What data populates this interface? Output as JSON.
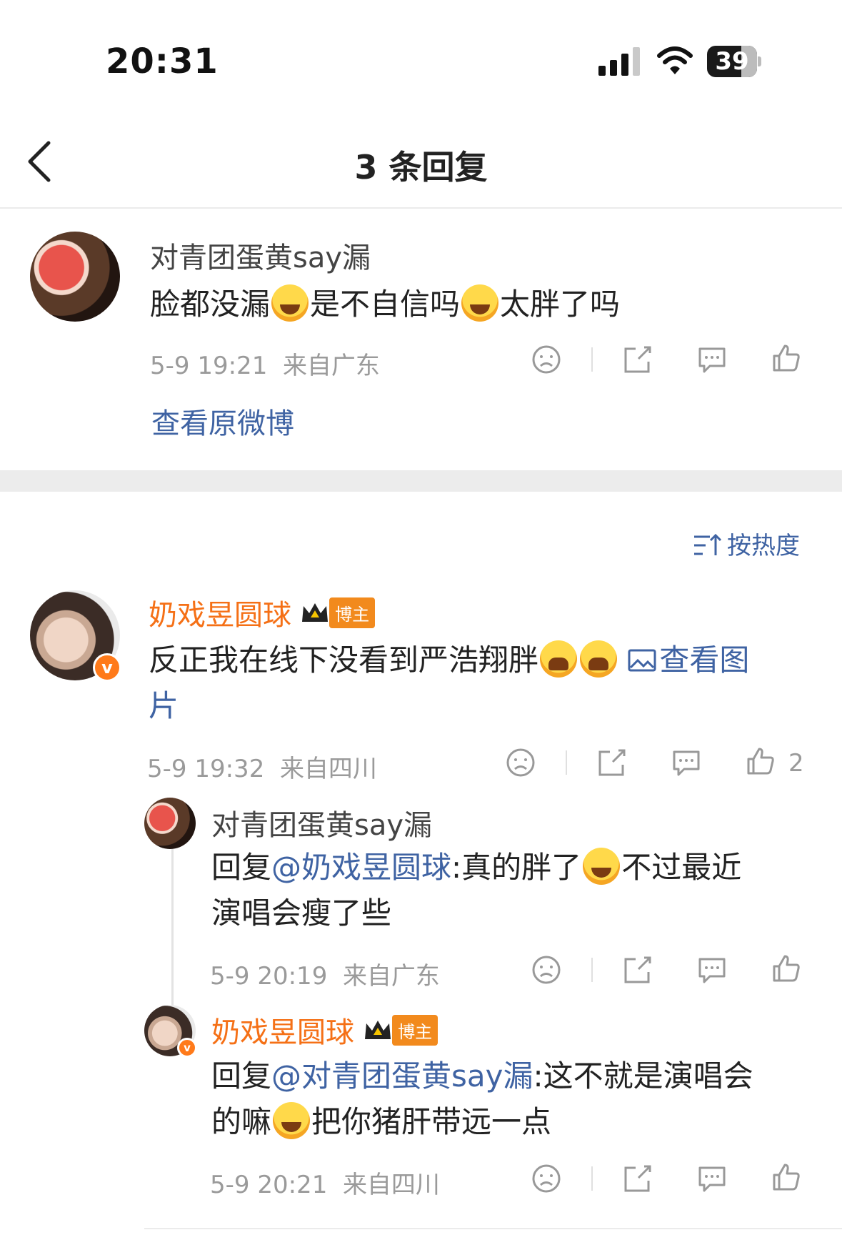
{
  "status_bar": {
    "time": "20:31",
    "battery": "39"
  },
  "header": {
    "title": "3 条回复"
  },
  "original_comment": {
    "user": "对青团蛋黄say漏",
    "text_parts": [
      "脸都没漏",
      "是不自信吗",
      "太胖了吗"
    ],
    "meta": "5-9 19:21  来自广东",
    "view_original": "查看原微博"
  },
  "sort": {
    "label": "按热度"
  },
  "main_comment": {
    "user": "奶戏昱圆球",
    "badge": "博主",
    "text": "反正我在线下没看到严浩翔胖",
    "view_image_1": "查看图",
    "view_image_2": "片",
    "meta": "5-9 19:32  来自四川",
    "likes": "2"
  },
  "replies": [
    {
      "user": "对青团蛋黄say漏",
      "prefix": "回复",
      "mention": "@奶戏昱圆球",
      "text_a": ":真的胖了",
      "text_b": "不过最近",
      "text_c": "演唱会瘦了些",
      "meta": "5-9 20:19  来自广东"
    },
    {
      "user": "奶戏昱圆球",
      "badge": "博主",
      "prefix": "回复",
      "mention": "@对青团蛋黄say漏",
      "text_a": ":这不就是演唱会",
      "text_b": "的嘛",
      "text_c": "把你猪肝带远一点",
      "meta": "5-9 20:21  来自四川"
    }
  ],
  "icons": [
    "signal-icon",
    "wifi-icon",
    "battery-icon",
    "back-icon",
    "dislike-icon",
    "share-icon",
    "comment-icon",
    "like-icon",
    "sort-icon",
    "image-icon",
    "crown-icon",
    "verified-icon"
  ],
  "colors": {
    "link": "#3f63a3",
    "orange_name": "#f57016",
    "meta": "#9a9a9a"
  }
}
